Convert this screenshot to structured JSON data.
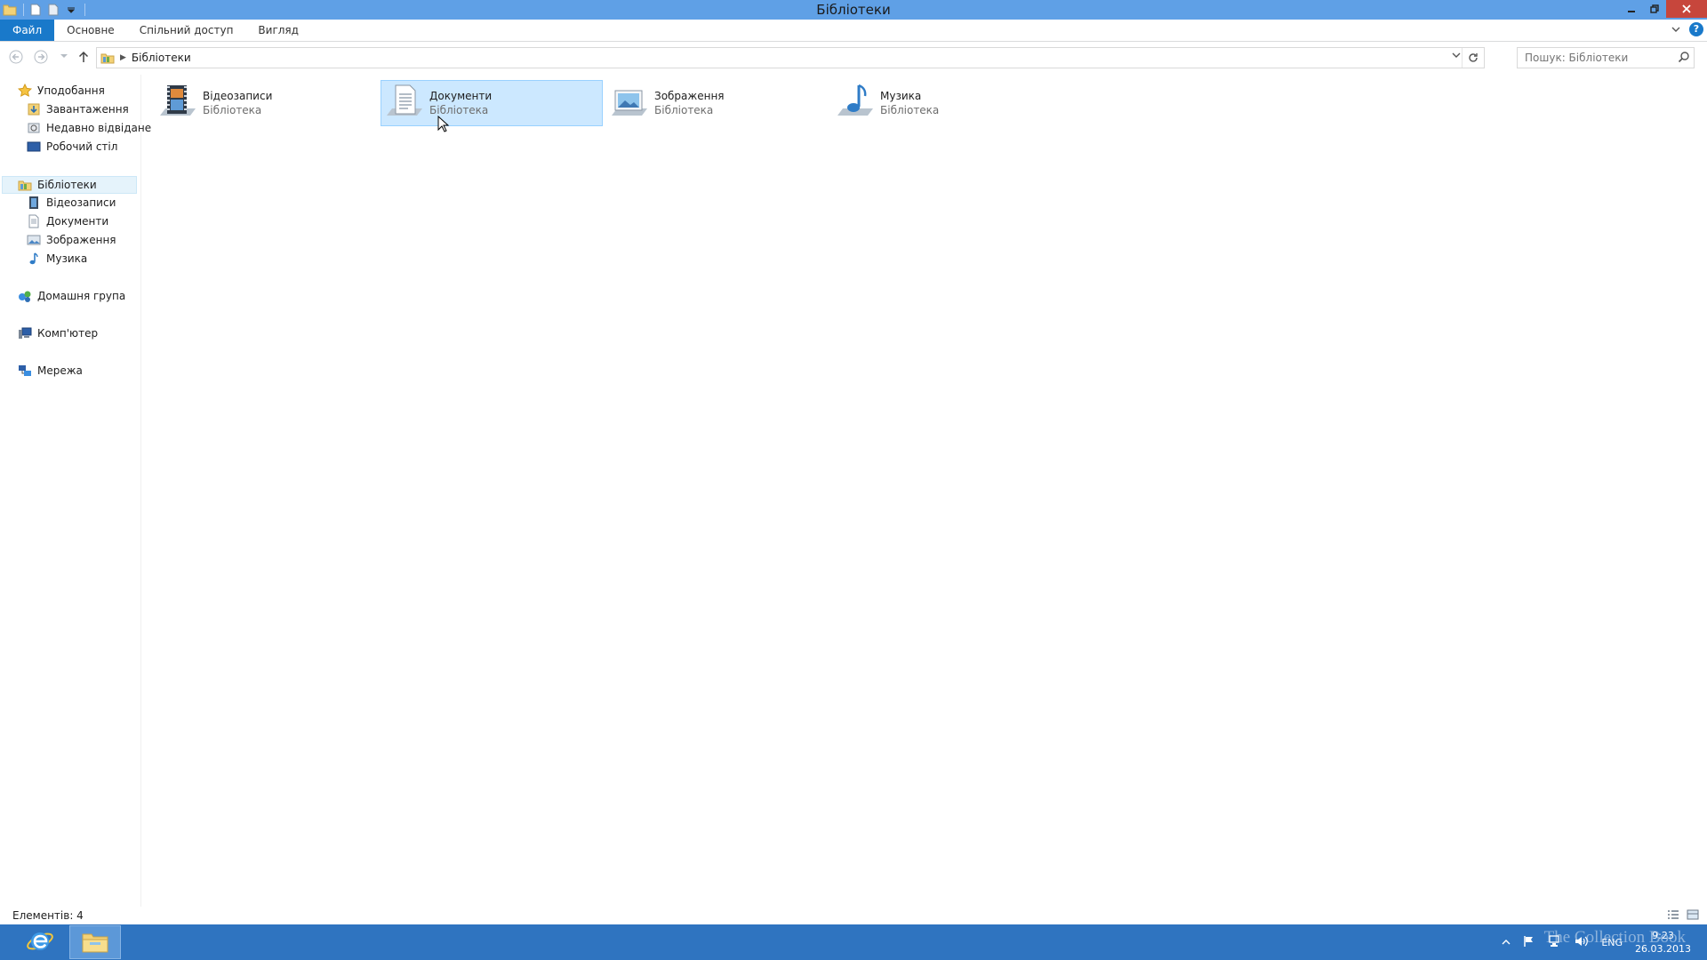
{
  "window": {
    "title": "Бібліотеки"
  },
  "ribbon": {
    "tabs": [
      {
        "label": "Файл"
      },
      {
        "label": "Основне"
      },
      {
        "label": "Спільний доступ"
      },
      {
        "label": "Вигляд"
      }
    ],
    "help_label": "?"
  },
  "address": {
    "path": "Бібліотеки",
    "search_placeholder": "Пошук: Бібліотеки"
  },
  "navpane": {
    "favorites": {
      "label": "Уподобання",
      "items": [
        {
          "label": "Завантаження",
          "icon": "downloads-icon"
        },
        {
          "label": "Недавно відвідане",
          "icon": "recent-places-icon"
        },
        {
          "label": "Робочий стіл",
          "icon": "desktop-icon"
        }
      ]
    },
    "libraries": {
      "label": "Бібліотеки",
      "items": [
        {
          "label": "Відеозаписи",
          "icon": "videos-icon"
        },
        {
          "label": "Документи",
          "icon": "documents-icon"
        },
        {
          "label": "Зображення",
          "icon": "pictures-icon"
        },
        {
          "label": "Музика",
          "icon": "music-icon"
        }
      ]
    },
    "homegroup": {
      "label": "Домашня група"
    },
    "computer": {
      "label": "Комп'ютер"
    },
    "network": {
      "label": "Мережа"
    }
  },
  "content": {
    "items": [
      {
        "name": "Відеозаписи",
        "type": "Бібліотека",
        "icon": "videos-library-icon",
        "selected": false
      },
      {
        "name": "Документи",
        "type": "Бібліотека",
        "icon": "documents-library-icon",
        "selected": true
      },
      {
        "name": "Зображення",
        "type": "Бібліотека",
        "icon": "pictures-library-icon",
        "selected": false
      },
      {
        "name": "Музика",
        "type": "Бібліотека",
        "icon": "music-library-icon",
        "selected": false
      }
    ]
  },
  "statusbar": {
    "item_count": "Елементів: 4"
  },
  "taskbar": {
    "tray": {
      "language": "ENG",
      "time": "9:23",
      "date": "26.03.2013"
    },
    "watermark": "The Collection Book"
  },
  "colors": {
    "titlebar": "#5fa0e6",
    "file_tab": "#1979ca",
    "selection_fill": "#cce8ff",
    "selection_border": "#99d1ff",
    "taskbar": "#2f74c0",
    "close_button": "#c7463c"
  }
}
